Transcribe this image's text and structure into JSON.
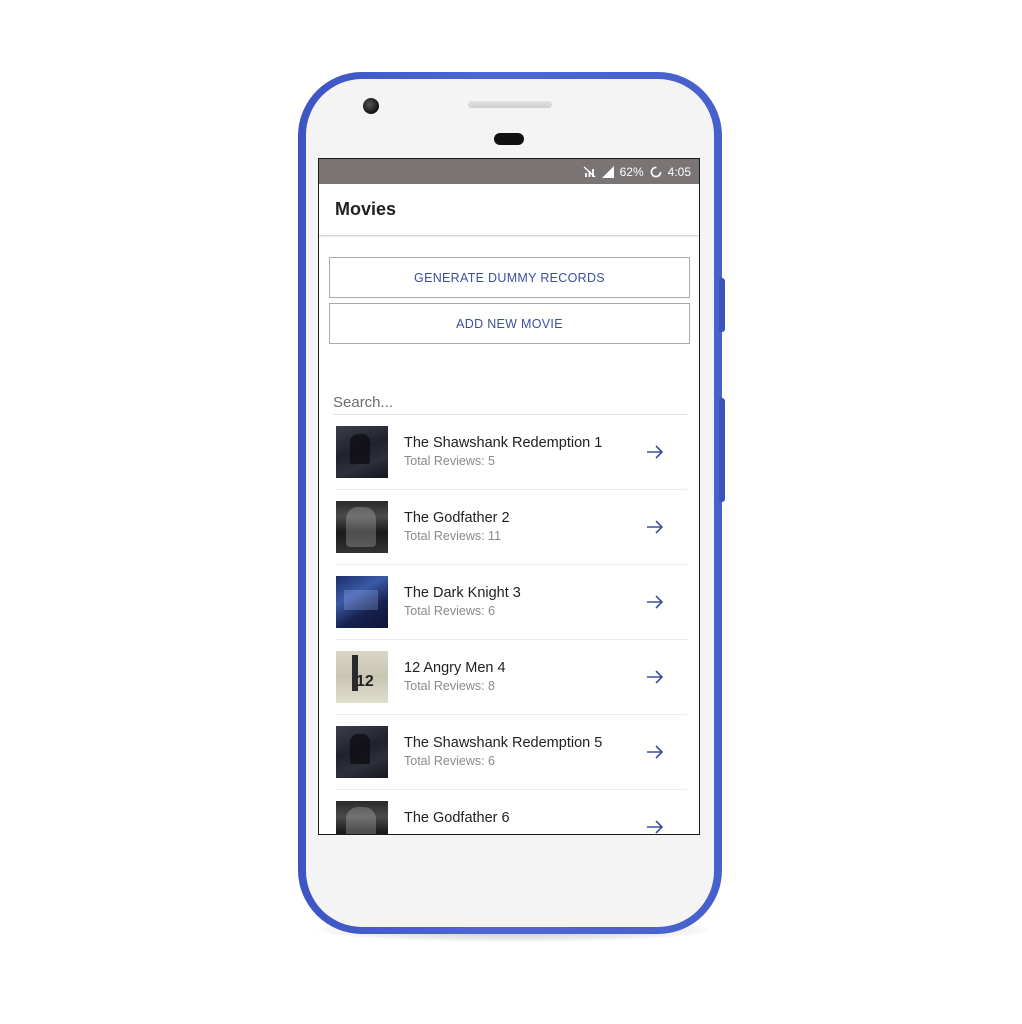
{
  "status_bar": {
    "battery": "62%",
    "time": "4:05",
    "icons": [
      "no-sim-icon",
      "signal-icon",
      "battery-charging-icon"
    ]
  },
  "app_bar": {
    "title": "Movies"
  },
  "actions": {
    "generate_label": "GENERATE DUMMY RECORDS",
    "add_label": "ADD NEW MOVIE"
  },
  "search": {
    "placeholder": "Search..."
  },
  "movies": [
    {
      "title": "The Shawshank Redemption 1",
      "reviews": "Total Reviews: 5"
    },
    {
      "title": "The Godfather 2",
      "reviews": "Total Reviews: 11"
    },
    {
      "title": "The Dark Knight 3",
      "reviews": "Total Reviews: 6"
    },
    {
      "title": "12 Angry Men 4",
      "reviews": "Total Reviews: 8"
    },
    {
      "title": "The Shawshank Redemption 5",
      "reviews": "Total Reviews: 6"
    },
    {
      "title": "The Godfather 6",
      "reviews": ""
    }
  ],
  "colors": {
    "phone_body": "#4660cc",
    "status_bar": "#7a7574",
    "accent": "#3d4f9e"
  }
}
